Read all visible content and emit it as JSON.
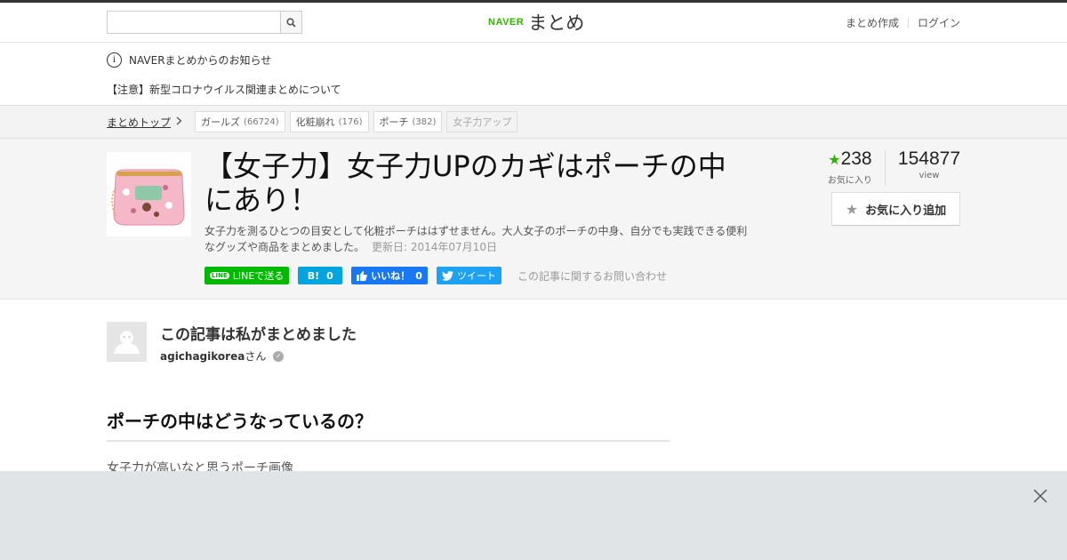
{
  "header": {
    "logo_naver": "NAVER",
    "logo_matome": "まとめ",
    "create_link": "まとめ作成",
    "login_link": "ログイン",
    "search_placeholder": ""
  },
  "notice": {
    "heading": "NAVERまとめからのお知らせ",
    "link": "【注意】新型コロナウイルス関連まとめについて"
  },
  "breadcrumb": {
    "top": "まとめトップ",
    "tags": [
      {
        "label": "ガールズ",
        "count": "(66724)"
      },
      {
        "label": "化粧崩れ",
        "count": "(176)"
      },
      {
        "label": "ポーチ",
        "count": "(382)"
      },
      {
        "label": "女子力アップ",
        "count": ""
      }
    ]
  },
  "article": {
    "title": "【女子力】女子力UPのカギはポーチの中にあり！",
    "description": "女子力を測るひとつの目安として化粧ポーチははずせません。大人女子のポーチの中身、自分でも実践できる便利なグッズや商品をまとめました。",
    "updated": "更新日: 2014年07月10日",
    "inquiry": "この記事に関するお問い合わせ"
  },
  "share": {
    "line_logo": "LINE",
    "line_label": "LINEで送る",
    "hatena_label": "B!",
    "hatena_count": "0",
    "fb_label": "いいね！",
    "fb_count": "0",
    "tweet_label": "ツイート"
  },
  "stats": {
    "favorites": "238",
    "favorites_label": "お気に入り",
    "views": "154877",
    "views_label": "view",
    "fav_button": "お気に入り追加"
  },
  "author": {
    "heading": "この記事は私がまとめました",
    "name": "agichagikorea",
    "suffix": "さん"
  },
  "content": {
    "section_heading": "ポーチの中はどうなっているの？",
    "text": "女子力が高いなと思うポーチ画像"
  },
  "colors": {
    "naver_green": "#2db400",
    "line_green": "#00b900",
    "hatena_blue": "#00a4de",
    "fb_blue": "#1877f2",
    "twitter_blue": "#1da1f2"
  }
}
